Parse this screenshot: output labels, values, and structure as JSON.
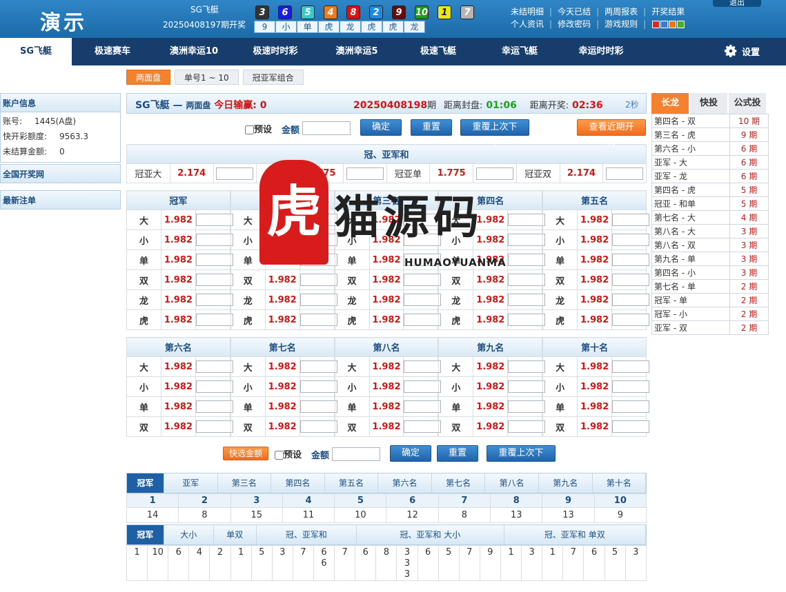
{
  "header": {
    "logo": "演示",
    "product_name": "SG飞艇",
    "last_issue": "20250408197期开奖",
    "balls": [
      {
        "num": "3",
        "color": "#333333"
      },
      {
        "num": "6",
        "color": "#1a1af0"
      },
      {
        "num": "5",
        "color": "#33cccc"
      },
      {
        "num": "4",
        "color": "#f07a1a"
      },
      {
        "num": "8",
        "color": "#e01010"
      },
      {
        "num": "2",
        "color": "#1a8ce8"
      },
      {
        "num": "9",
        "color": "#6a0a0a"
      },
      {
        "num": "10",
        "color": "#1aa01a"
      },
      {
        "num": "1",
        "color": "#e8e81a"
      },
      {
        "num": "7",
        "color": "#b5b5b5"
      }
    ],
    "summary": [
      "9",
      "小",
      "单",
      "虎",
      "龙",
      "虎",
      "虎",
      "龙"
    ],
    "links_row1": [
      "未结明细",
      "今天已结",
      "两周报表",
      "开奖结果"
    ],
    "links_row2": [
      "个人资讯",
      "修改密码",
      "游戏规则"
    ],
    "exit": "退出",
    "swatches": [
      "#d42b2b",
      "#3a7bd5",
      "#e37a1c",
      "#5aa829"
    ]
  },
  "nav": {
    "items": [
      "SG飞艇",
      "极速赛车",
      "澳洲幸运10",
      "极速时时彩",
      "澳洲幸运5",
      "极速飞艇",
      "幸运飞艇",
      "幸运时时彩"
    ],
    "settings": "设置"
  },
  "subtabs": [
    "两面盘",
    "单号1 ~ 10",
    "冠亚军组合"
  ],
  "sidebar": {
    "account_title": "账户信息",
    "account_label": "账号:",
    "account_value": "1445(A盘)",
    "quota_label": "快开彩额度:",
    "quota_value": "9563.3",
    "unsettled_label": "未结算金额:",
    "unsettled_value": "0",
    "lottery_net": "全国开奖网",
    "latest_bets": "最新注单"
  },
  "bet": {
    "game": "SG飞艇",
    "dash": "—",
    "mode": "两面盘",
    "today_label": "今日输赢:",
    "today_value": "0",
    "issue": "20250408198",
    "issue_suffix": "期",
    "close_label": "距离封盘:",
    "close_time": "01:06",
    "open_label": "距离开奖:",
    "open_time": "02:36",
    "refresh": "2秒",
    "preset": "预设",
    "amount": "金额",
    "confirm": "确定",
    "reset": "重置",
    "repeat": "重覆上次下单",
    "recent": "查看近期开奖",
    "quick": "快选金额"
  },
  "sum_section": {
    "title": "冠、亚军和",
    "items": [
      {
        "label": "冠亚大",
        "odd": "2.174"
      },
      {
        "label": "冠亚小",
        "odd": "1.775"
      },
      {
        "label": "冠亚单",
        "odd": "1.775"
      },
      {
        "label": "冠亚双",
        "odd": "2.174"
      }
    ]
  },
  "ranks_top": {
    "names": [
      "冠军",
      "亚军",
      "第三名",
      "第四名",
      "第五名"
    ],
    "rows": [
      "大",
      "小",
      "单",
      "双",
      "龙",
      "虎"
    ],
    "odd": "1.982"
  },
  "ranks_bottom": {
    "names": [
      "第六名",
      "第七名",
      "第八名",
      "第九名",
      "第十名"
    ],
    "rows": [
      "大",
      "小",
      "单",
      "双"
    ],
    "odd": "1.982"
  },
  "stats": {
    "tabs": [
      "冠军",
      "亚军",
      "第三名",
      "第四名",
      "第五名",
      "第六名",
      "第七名",
      "第八名",
      "第九名",
      "第十名"
    ],
    "numbers": [
      "1",
      "2",
      "3",
      "4",
      "5",
      "6",
      "7",
      "8",
      "9",
      "10"
    ],
    "counts": [
      "14",
      "8",
      "15",
      "11",
      "10",
      "12",
      "8",
      "13",
      "13",
      "9"
    ],
    "tabs2": [
      "冠军",
      "大小",
      "单双",
      "冠、亚军和",
      "冠、亚军和 大小",
      "冠、亚军和 单双"
    ],
    "road": [
      [
        "1"
      ],
      [
        "10"
      ],
      [
        "6"
      ],
      [
        "4"
      ],
      [
        "2"
      ],
      [
        "1"
      ],
      [
        "5"
      ],
      [
        "3"
      ],
      [
        "7"
      ],
      [
        "6",
        "6"
      ],
      [
        "7"
      ],
      [
        "6"
      ],
      [
        "8"
      ],
      [
        "3",
        "3",
        "3"
      ],
      [
        "6"
      ],
      [
        "5"
      ],
      [
        "7"
      ],
      [
        "9"
      ],
      [
        "1"
      ],
      [
        "3"
      ],
      [
        "1"
      ],
      [
        "7"
      ],
      [
        "6"
      ],
      [
        "5"
      ],
      [
        "3"
      ]
    ]
  },
  "right": {
    "tabs": [
      "长龙",
      "快投",
      "公式投"
    ],
    "rows": [
      {
        "name": "第四名 - 双",
        "n": "10 期"
      },
      {
        "name": "第三名 - 虎",
        "n": "9 期"
      },
      {
        "name": "第六名 - 小",
        "n": "6 期"
      },
      {
        "name": "亚军 - 大",
        "n": "6 期"
      },
      {
        "name": "亚军 - 龙",
        "n": "6 期"
      },
      {
        "name": "第四名 - 虎",
        "n": "5 期"
      },
      {
        "name": "冠亚 - 和单",
        "n": "5 期"
      },
      {
        "name": "第七名 - 大",
        "n": "4 期"
      },
      {
        "name": "第八名 - 大",
        "n": "3 期"
      },
      {
        "name": "第八名 - 双",
        "n": "3 期"
      },
      {
        "name": "第九名 - 单",
        "n": "3 期"
      },
      {
        "name": "第四名 - 小",
        "n": "3 期"
      },
      {
        "name": "第七名 - 单",
        "n": "2 期"
      },
      {
        "name": "冠军 - 单",
        "n": "2 期"
      },
      {
        "name": "冠军 - 小",
        "n": "2 期"
      },
      {
        "name": "亚军 - 双",
        "n": "2 期"
      }
    ]
  },
  "watermark": {
    "big": "猫源码",
    "small": "HUMAOYUANMA",
    "seal": "虎"
  }
}
